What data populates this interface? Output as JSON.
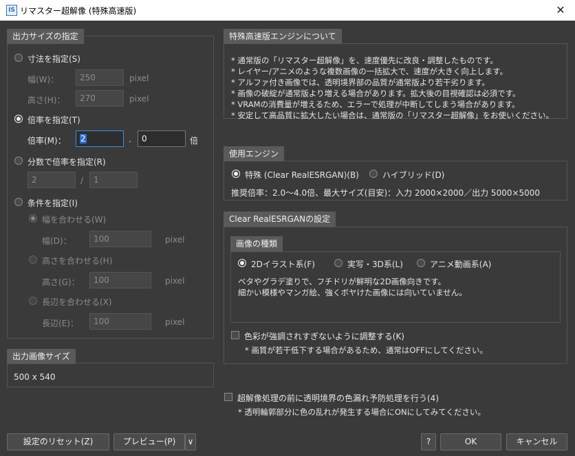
{
  "window": {
    "title": "リマスター超解像 (特殊高速版)",
    "icon_text": "IS"
  },
  "size_section": {
    "title": "出力サイズの指定",
    "dimension_radio": "寸法を指定(S)",
    "width_label": "幅(W)：",
    "width_value": "250",
    "width_unit": "pixel",
    "height_label": "高さ(H)：",
    "height_value": "270",
    "height_unit": "pixel",
    "scale_radio": "倍率を指定(T)",
    "scale_label": "倍率(M)：",
    "scale_int": "2",
    "scale_dot": ".",
    "scale_frac": "0",
    "scale_unit": "倍",
    "fraction_radio": "分数で倍率を指定(R)",
    "fraction_num": "2",
    "fraction_slash": "/",
    "fraction_den": "1",
    "condition_radio": "条件を指定(I)",
    "fit_width_radio": "幅を合わせる(W)",
    "fit_width_label": "幅(D)：",
    "fit_width_value": "100",
    "fit_width_unit": "pixel",
    "fit_height_radio": "高さを合わせる(H)",
    "fit_height_label": "高さ(G)：",
    "fit_height_value": "100",
    "fit_height_unit": "pixel",
    "fit_long_radio": "長辺を合わせる(X)",
    "fit_long_label": "長辺(E)：",
    "fit_long_value": "100",
    "fit_long_unit": "pixel"
  },
  "output_section": {
    "title": "出力画像サイズ",
    "value": "500 x 540"
  },
  "about_section": {
    "title": "特殊高速版エンジンについて",
    "lines": [
      "* 通常版の「リマスター超解像」を、速度優先に改良・調整したものです。",
      "* レイヤー/アニメのような複数画像の一括拡大で、速度が大きく向上します。",
      "* アルファ付き画像では、透明境界部の品質が通常版より若干劣ります。",
      "* 画像の破綻が通常版より増える場合があります。拡大後の目視確認は必須です。",
      "* VRAMの消費量が増えるため、エラーで処理が中断してしまう場合があります。",
      "* 安定して高品質に拡大したい場合は、通常版の「リマスター超解像」をお使いください。"
    ]
  },
  "engine_section": {
    "title": "使用エンジン",
    "option1": "特殊 (Clear RealESRGAN)(B)",
    "option2": "ハイブリッド(D)",
    "recommend": "推奨倍率：2.0～4.0倍、最大サイズ(目安)：入力 2000×2000／出力 5000×5000"
  },
  "clear_section": {
    "title": "Clear RealESRGANの設定",
    "type_title": "画像の種類",
    "type1": "2Dイラスト系(F)",
    "type2": "実写・3D系(L)",
    "type3": "アニメ動画系(A)",
    "desc1": "ベタやグラデ塗りで、フチドリが鮮明な2D画像向きです。",
    "desc2": "細かい模様やマンガ絵、強くボヤけた画像には向いていません。",
    "color_check": "色彩が強調されすぎないように調整する(K)",
    "color_note": "* 画質が若干低下する場合があるため、通常はOFFにしてください。"
  },
  "pre_process": {
    "check": "超解像処理の前に透明境界の色漏れ予防処理を行う(4)",
    "note": "* 透明輪郭部分に色の乱れが発生する場合にONにしてみてください。"
  },
  "buttons": {
    "reset": "設定のリセット(Z)",
    "preview": "プレビュー(P)",
    "preview_arrow": "∨",
    "help": "?",
    "ok": "OK",
    "cancel": "キャンセル"
  }
}
